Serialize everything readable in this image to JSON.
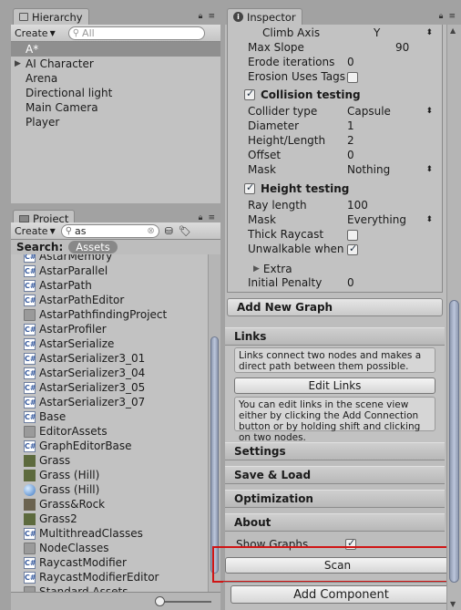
{
  "hierarchy": {
    "tab_label": "Hierarchy",
    "create_label": "Create",
    "search_placeholder": "All",
    "items": [
      {
        "label": "A*",
        "selected": true
      },
      {
        "label": "AI Character",
        "expandable": true
      },
      {
        "label": "Arena"
      },
      {
        "label": "Directional light"
      },
      {
        "label": "Main Camera"
      },
      {
        "label": "Player"
      }
    ]
  },
  "project": {
    "tab_label": "Project",
    "create_label": "Create",
    "search_value": "as",
    "search_prefix": "Search:",
    "search_scope": "Assets",
    "items": [
      {
        "label": "AstarMemory",
        "icon": "cs-script-icon"
      },
      {
        "label": "AstarParallel",
        "icon": "cs-script-icon"
      },
      {
        "label": "AstarPath",
        "icon": "cs-script-icon"
      },
      {
        "label": "AstarPathEditor",
        "icon": "cs-script-icon"
      },
      {
        "label": "AstarPathfindingProject",
        "icon": "folder-icon"
      },
      {
        "label": "AstarProfiler",
        "icon": "cs-script-icon"
      },
      {
        "label": "AstarSerialize",
        "icon": "cs-script-icon"
      },
      {
        "label": "AstarSerializer3_01",
        "icon": "cs-script-icon"
      },
      {
        "label": "AstarSerializer3_04",
        "icon": "cs-script-icon"
      },
      {
        "label": "AstarSerializer3_05",
        "icon": "cs-script-icon"
      },
      {
        "label": "AstarSerializer3_07",
        "icon": "cs-script-icon"
      },
      {
        "label": "Base",
        "icon": "cs-script-icon"
      },
      {
        "label": "EditorAssets",
        "icon": "folder-icon"
      },
      {
        "label": "GraphEditorBase",
        "icon": "cs-script-icon"
      },
      {
        "label": "Grass",
        "icon": "texture-icon"
      },
      {
        "label": "Grass (Hill)",
        "icon": "texture-icon"
      },
      {
        "label": "Grass (Hill)",
        "icon": "material-sphere-icon"
      },
      {
        "label": "Grass&Rock",
        "icon": "texture-rock-icon"
      },
      {
        "label": "Grass2",
        "icon": "texture-icon"
      },
      {
        "label": "MultithreadClasses",
        "icon": "cs-script-icon"
      },
      {
        "label": "NodeClasses",
        "icon": "folder-icon"
      },
      {
        "label": "RaycastModifier",
        "icon": "cs-script-icon"
      },
      {
        "label": "RaycastModifierEditor",
        "icon": "cs-script-icon"
      },
      {
        "label": "Standard Assets",
        "icon": "folder-icon"
      }
    ]
  },
  "inspector": {
    "tab_label": "Inspector",
    "fields_top": [
      {
        "label": "Climb Axis",
        "value": "Y",
        "dropdown": true,
        "indent": true
      },
      {
        "label": "Max Slope",
        "value": "90"
      },
      {
        "label": "Erode iterations",
        "value": "0"
      },
      {
        "label": "Erosion Uses Tags",
        "checkbox": false
      }
    ],
    "collision": {
      "header": "Collision testing",
      "enabled": true,
      "fields": [
        {
          "label": "Collider type",
          "value": "Capsule",
          "dropdown": true
        },
        {
          "label": "Diameter",
          "value": "1"
        },
        {
          "label": "Height/Length",
          "value": "2"
        },
        {
          "label": "Offset",
          "value": "0"
        },
        {
          "label": "Mask",
          "value": "Nothing",
          "dropdown": true
        }
      ]
    },
    "height": {
      "header": "Height testing",
      "enabled": true,
      "fields": [
        {
          "label": "Ray length",
          "value": "100"
        },
        {
          "label": "Mask",
          "value": "Everything",
          "dropdown": true
        },
        {
          "label": "Thick Raycast",
          "checkbox": false
        },
        {
          "label": "Unwalkable when n",
          "checkbox": true
        }
      ]
    },
    "extra_label": "Extra",
    "initial_penalty_label": "Initial Penalty",
    "initial_penalty_value": "0",
    "add_graph_label": "Add New Graph",
    "links": {
      "header": "Links",
      "help1": "Links connect two nodes and makes a direct path between them possible.",
      "button": "Edit Links",
      "help2": "You can edit links in the scene view either by clicking the Add Connection button or by holding shift and clicking on two nodes."
    },
    "sections": [
      "Settings",
      "Save & Load",
      "Optimization",
      "About"
    ],
    "show_graphs_label": "Show Graphs",
    "show_graphs": true,
    "scan_label": "Scan",
    "add_component_label": "Add Component"
  }
}
